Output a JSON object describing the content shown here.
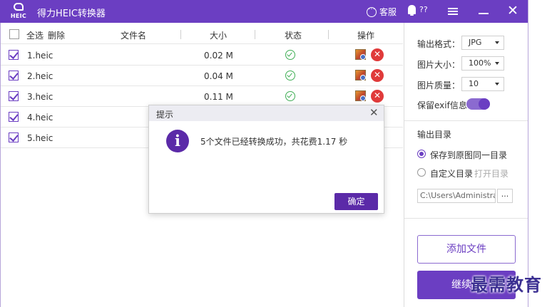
{
  "app": {
    "title": "得力HEIC转换器",
    "logo_text": "HEIC",
    "service_label": "客服",
    "notification_count": "??"
  },
  "table": {
    "header": {
      "select_all": "全选",
      "delete": "删除",
      "filename": "文件名",
      "size": "大小",
      "status": "状态",
      "action": "操作"
    },
    "rows": [
      {
        "name": "1.heic",
        "size": "0.02 M",
        "checked": true,
        "status_icon": "check-circle-icon"
      },
      {
        "name": "2.heic",
        "size": "0.04 M",
        "checked": true,
        "status_icon": "check-circle-icon"
      },
      {
        "name": "3.heic",
        "size": "0.11 M",
        "checked": true,
        "status_icon": "check-circle-icon"
      },
      {
        "name": "4.heic",
        "size": "",
        "checked": true,
        "status_icon": ""
      },
      {
        "name": "5.heic",
        "size": "",
        "checked": true,
        "status_icon": ""
      }
    ]
  },
  "settings": {
    "format_label": "输出格式：",
    "format_value": "JPG",
    "size_label": "图片大小：",
    "size_value": "100%",
    "quality_label": "图片质量：",
    "quality_value": "10",
    "exif_label": "保留exif信息",
    "exif_enabled": true,
    "output_dir_title": "输出目录",
    "radio_same_dir": "保存到原图同一目录",
    "radio_custom_dir": "自定义目录",
    "open_dir": "打开目录",
    "path_value": "C:\\Users\\Administra",
    "browse_label": "...",
    "add_file_button": "添加文件",
    "continue_button": "继续转"
  },
  "dialog": {
    "title": "提示",
    "close": "✕",
    "message": "5个文件已经转换成功，共花费1.17 秒",
    "ok_button": "确定"
  },
  "watermark": "最需教育",
  "colors": {
    "accent": "#6b3ec2",
    "dialog_accent": "#5b2aa8",
    "success": "#3fae55",
    "danger": "#e03a3a"
  }
}
